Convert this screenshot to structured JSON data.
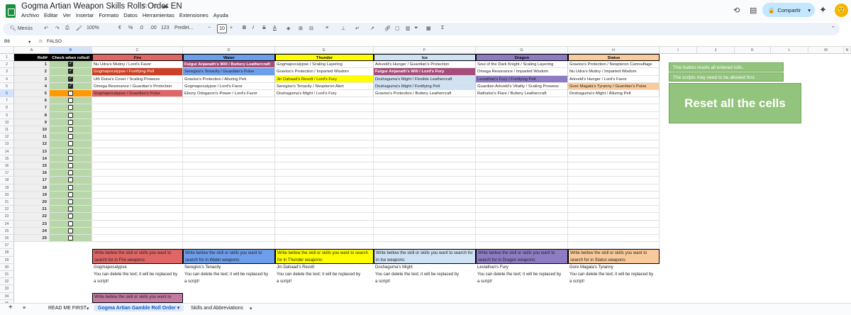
{
  "app": {
    "title": "Gogma Artian Weapon Skills Rolls Order EN",
    "menus": [
      "Archivo",
      "Editar",
      "Ver",
      "Insertar",
      "Formato",
      "Datos",
      "Herramientas",
      "Extensiones",
      "Ayuda"
    ],
    "share_label": "Compartir"
  },
  "toolbar": {
    "search": "Menús",
    "zoom": "100%",
    "currency": "€",
    "percent": "%",
    "dec_dec": ".0",
    "inc_dec": ".00",
    "num": "123",
    "font": "Predet...",
    "font_size": "10"
  },
  "formula": {
    "cell_ref": "B6",
    "fx": "fx",
    "value": "FALSO"
  },
  "columns": [
    "A",
    "B",
    "C",
    "D",
    "E",
    "F",
    "G",
    "H",
    "I",
    "J",
    "K",
    "L",
    "M",
    "N"
  ],
  "headers": {
    "roll": "Roll#",
    "check": "Check when rolled!",
    "fire": "Fire",
    "water": "Water",
    "thunder": "Thunder",
    "ice": "Ice",
    "dragon": "Dragon",
    "status": "Status"
  },
  "colors": {
    "fire": "#e06666",
    "water": "#6d9eeb",
    "thunder": "#ffff00",
    "ice": "#cfe2f3",
    "dragon": "#8e7cc3",
    "status": "#f9cb9c",
    "light_fire": "#f4cccc",
    "light_water": "#c9daf8",
    "light_thunder": "#fff2cc",
    "light_ice": "#dae8fc",
    "light_dragon": "#d9d2e9",
    "light_status": "#fce5cd",
    "checkbox_col": "#b7d7a8",
    "green_btn": "#93c47d",
    "orange": "#ff9900",
    "magenta": "#c27ba0",
    "darkred": "#cc4125",
    "plum": "#a64d79"
  },
  "rows": [
    {
      "n": "1",
      "checked": true,
      "cells": [
        "Nu Udra's Mutiny / Lord's Favor",
        "Fulgur Anjanath's Will / Buttery Leathercraft",
        "Gogmapocalypse / Scaling Layering",
        "Arkveld's Hunger / Guardian's Protection",
        "Soul of the Dark Knight / Scaling Layering",
        "Gravios's Protection / Neopteron Camouflage"
      ]
    },
    {
      "n": "2",
      "checked": true,
      "cells": [
        "Gogmapocalypse / Fortifying Pelt",
        "Seregios's Tenacity / Guardian's Pulse",
        "Gravios's Protection / Imparted Wisdom",
        "Fulgur Anjanath's Will / Lord's Fury",
        "Omega Resonance / Imparted Wisdom",
        "Nu Udra's Mutiny / Imparted Wisdom"
      ]
    },
    {
      "n": "3",
      "checked": true,
      "cells": [
        "Uth Duna's Cover / Scaling Prowess",
        "Gravios's Protection / Alluring Pelt",
        "Jin Dahaad's Revolt / Lord's Fury",
        "Doshaguma's Might / Flexible Leathercraft",
        "Leviathan's Fury / Fortifying Pelt",
        "Arkveld's Hunger / Lord's Favor"
      ]
    },
    {
      "n": "4",
      "checked": true,
      "cells": [
        "Omega Resonance / Guardian's Protection",
        "Gogmapocalypse / Lord's Favor",
        "Seregios's Tenacity / Neopteron Alert",
        "Doshaguma's Might / Fortifying Pelt",
        "Guardian Arkveld's Vitality / Scaling Prowess",
        "Gore Magala's Tyranny / Guardian's Pulse"
      ]
    },
    {
      "n": "5",
      "checked": false,
      "cells": [
        "Gogmapocalypse / Guardian's Pulse",
        "Ebony Odogaron's Power / Lord's Favor",
        "Doshaguma's Might / Lord's Fury",
        "Gravios's Protection / Buttery Leathercraft",
        "Rathalos's Flare / Buttery Leathercraft",
        "Doshaguma's Might / Alluring Pelt"
      ]
    }
  ],
  "empty_rolls": [
    "6",
    "7",
    "8",
    "9",
    "10",
    "11",
    "12",
    "13",
    "14",
    "15",
    "16",
    "17",
    "18",
    "19",
    "20",
    "21",
    "22",
    "23",
    "24",
    "25"
  ],
  "notes": {
    "n1": "This button resets all entered rolls.",
    "n2": "The scripts may need to be allowed first.",
    "reset": "Reset all the cells"
  },
  "prompts": {
    "fire": "Write bellow the skill or skills you want to search for in Fire weapons:",
    "water": "Write bellow the skill or skills you want to search for in Water weapons:",
    "thunder": "Write bellow the skill or skills you want to search for in Thunder weapons:",
    "ice": "Write bellow the skill or skills you want to search for in Ice weapons:",
    "dragon": "Write bellow the skill or skills you want to search for in Dragon weapons:",
    "status": "Write bellow the skill or skills you want to search for in Status weapons:",
    "all": "Write bellow the skill or skills you want to search for ALL weapons:"
  },
  "searches": {
    "fire": "Gogmapocalypse",
    "water": "Seregios's Tenacity",
    "thunder": "Jin Dahaad's Revolt",
    "ice": "Doshaguma's Might",
    "dragon": "Leviathan's Fury",
    "status": "Gore Magala's Tyranny"
  },
  "delete_note_1": "You can delete the text; it will be replaced by",
  "delete_note_2": "a script!",
  "tabs": {
    "readme": "READ ME FIRST",
    "active": "Gogma Artian Gamble Roll Order",
    "skills": "Skills and Abbreviations"
  }
}
